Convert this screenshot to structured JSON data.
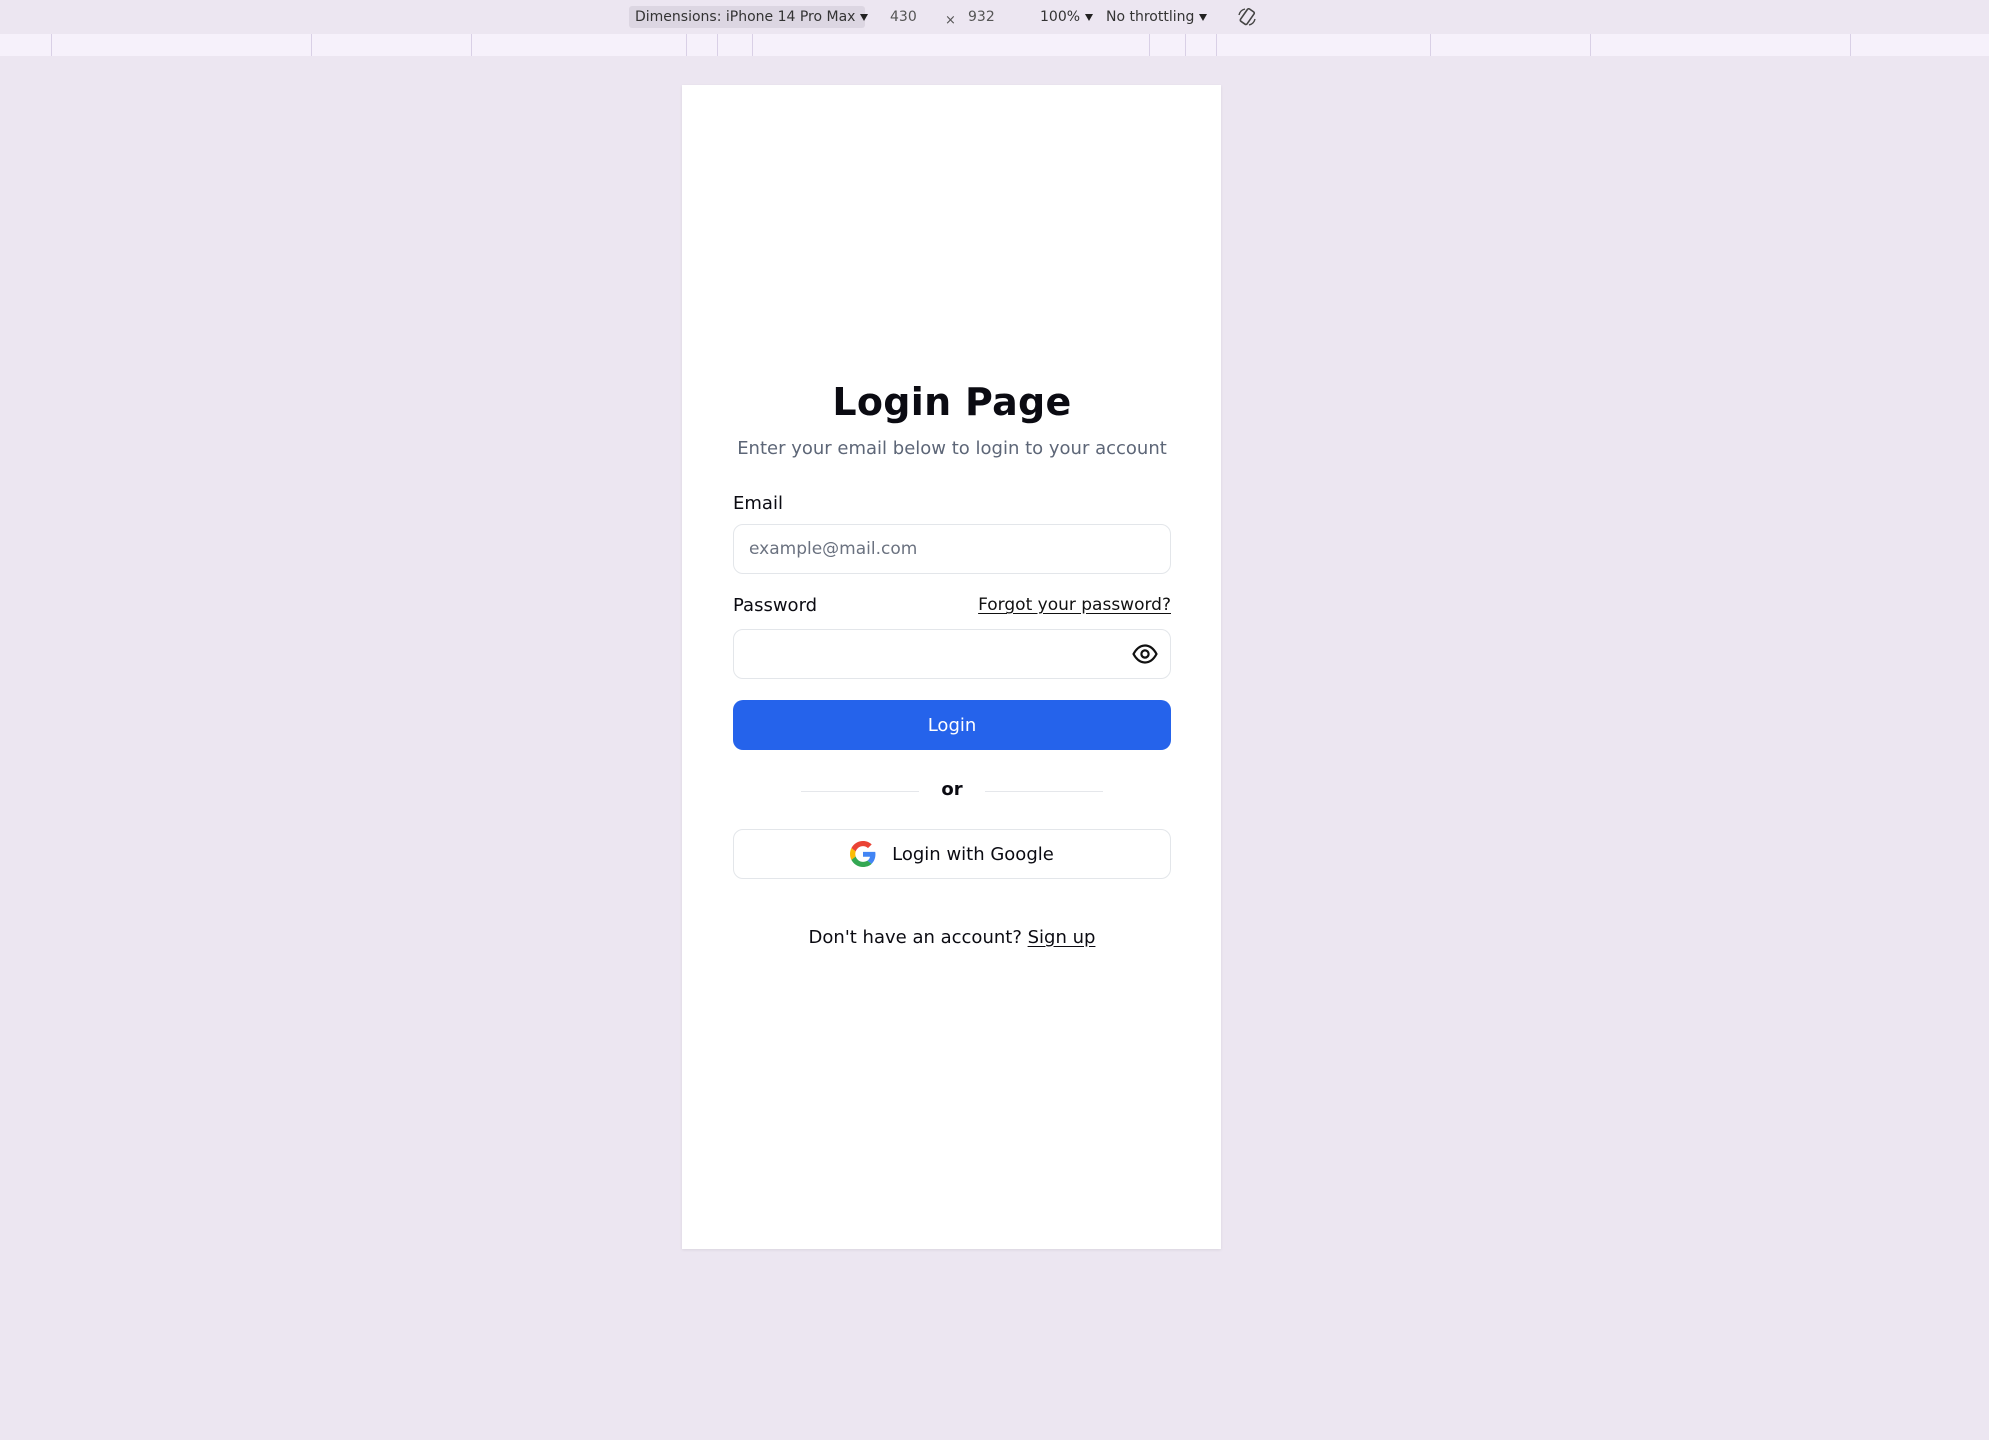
{
  "toolbar": {
    "dimensions_label": "Dimensions: iPhone 14 Pro Max",
    "width_value": "430",
    "times_symbol": "×",
    "height_value": "932",
    "zoom_label": "100%",
    "throttling_label": "No throttling"
  },
  "login": {
    "title": "Login Page",
    "subtitle": "Enter your email below to login to your account",
    "email_label": "Email",
    "email_placeholder": "example@mail.com",
    "password_label": "Password",
    "forgot_link": "Forgot your password?",
    "login_button": "Login",
    "divider_text": "or",
    "google_button": "Login with Google",
    "signup_prompt": "Don't have an account?",
    "signup_link": "Sign up"
  },
  "colors": {
    "primary": "#2563eb",
    "page_background": "#ece6f1",
    "viewport_background": "#ffffff"
  },
  "icons": {
    "eye": "eye-icon",
    "google": "google-icon",
    "rotate": "rotate-icon"
  }
}
